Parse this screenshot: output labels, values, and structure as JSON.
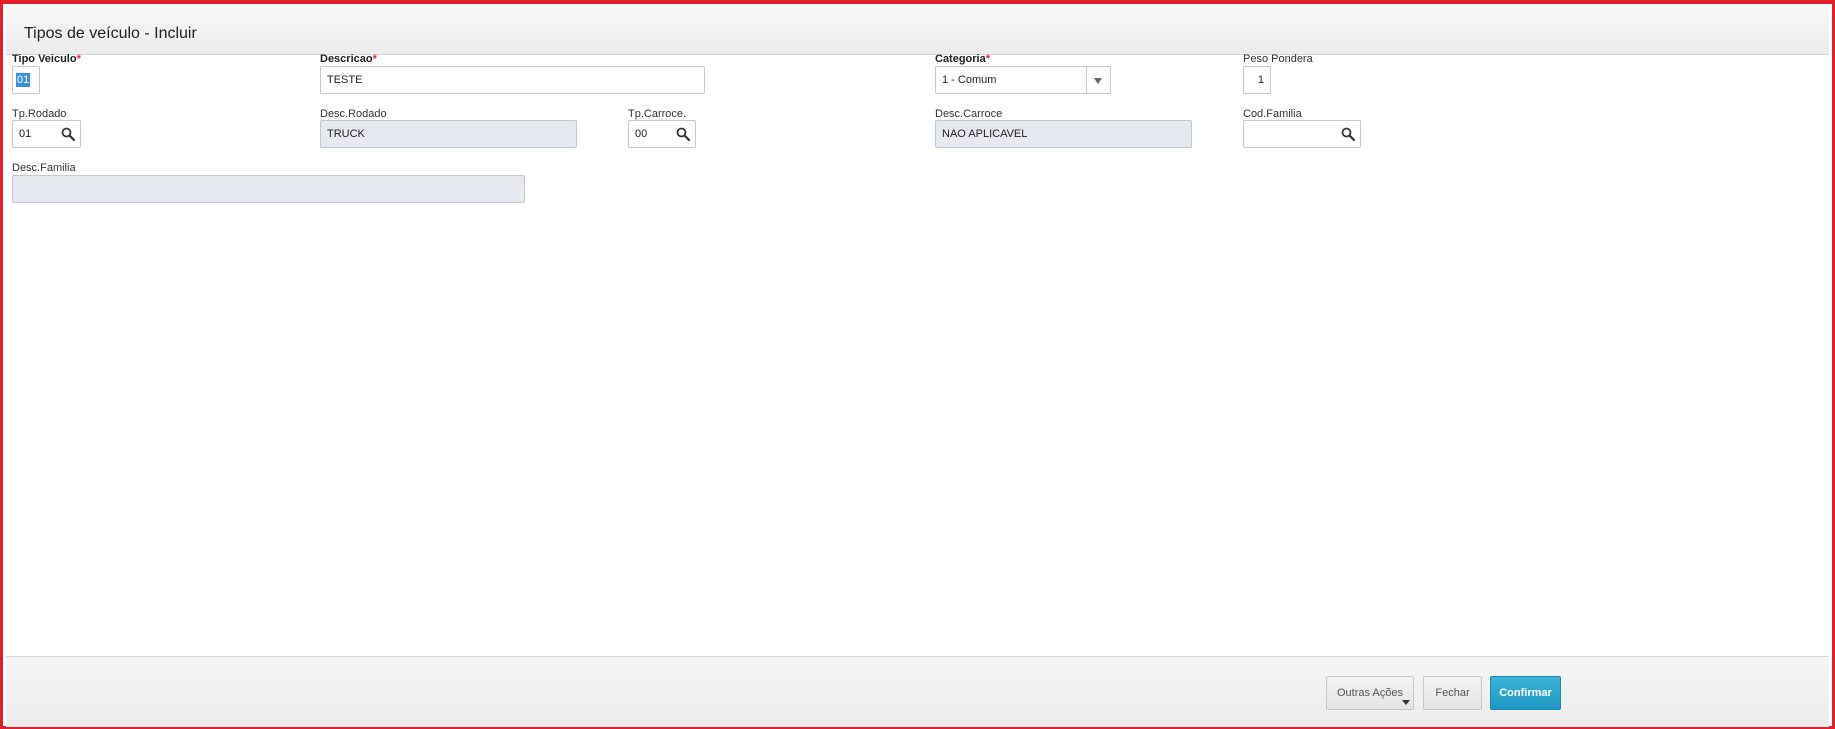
{
  "window": {
    "title": "Tipos de veículo - Incluir"
  },
  "form": {
    "tipo_veiculo": {
      "label": "Tipo Veiculo",
      "required_mark": "*",
      "value": "01"
    },
    "descricao": {
      "label": "Descricao",
      "required_mark": "*",
      "value": "TESTE"
    },
    "categoria": {
      "label": "Categoria",
      "required_mark": "*",
      "value": "1 - Comum"
    },
    "peso_pondera": {
      "label": "Peso Pondera",
      "value": "1"
    },
    "tp_rodado": {
      "label": "Tp.Rodado",
      "value": "01"
    },
    "desc_rodado": {
      "label": "Desc.Rodado",
      "value": "TRUCK"
    },
    "tp_carroce": {
      "label": "Tp.Carroce.",
      "value": "00"
    },
    "desc_carroce": {
      "label": "Desc.Carroce",
      "value": "NAO APLICAVEL"
    },
    "cod_familia": {
      "label": "Cod.Familia",
      "value": ""
    },
    "desc_familia": {
      "label": "Desc.Familia",
      "value": ""
    }
  },
  "footer": {
    "outras_acoes_label": "Outras Ações",
    "fechar_label": "Fechar",
    "confirmar_label": "Confirmar"
  },
  "icons": {
    "lookup": "search-icon",
    "dropdown": "chevron-down-icon"
  },
  "colors": {
    "frame_border": "#e3202a",
    "required": "#e3202a",
    "primary_button": "#26a3cc",
    "readonly_field": "#e6e9ef"
  }
}
